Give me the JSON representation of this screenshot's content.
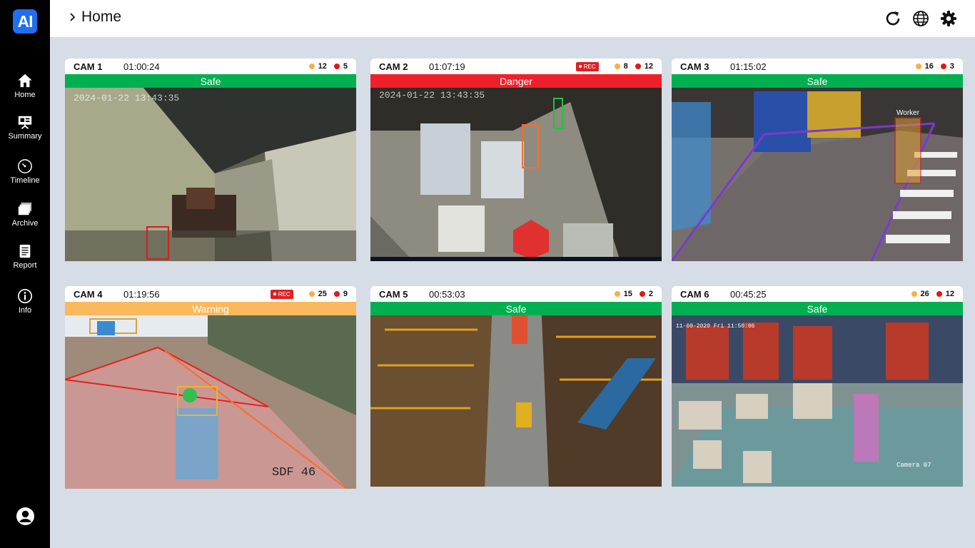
{
  "app": {
    "logo": "AI",
    "breadcrumb": "Home"
  },
  "sidebar": {
    "items": [
      {
        "label": "Home",
        "icon": "home-icon"
      },
      {
        "label": "Summary",
        "icon": "presentation-icon"
      },
      {
        "label": "Timeline",
        "icon": "clock-icon"
      },
      {
        "label": "Archive",
        "icon": "folders-icon"
      },
      {
        "label": "Report",
        "icon": "document-icon"
      },
      {
        "label": "Info",
        "icon": "info-icon"
      }
    ]
  },
  "topbar": {
    "icons": [
      "refresh-icon",
      "globe-icon",
      "settings-icon"
    ]
  },
  "status_colors": {
    "safe": "#00b050",
    "danger": "#f0202a",
    "warning": "#f9b95c",
    "count_a": "#f7b049",
    "count_b": "#e01818",
    "rec": "#e02020"
  },
  "cameras": [
    {
      "name": "CAM 1",
      "time": "01:00:24",
      "status": "Safe",
      "count_a": "12",
      "count_b": "5",
      "overlay_text": "2024-01-22 13:43:35"
    },
    {
      "name": "CAM 2",
      "time": "01:07:19",
      "status": "Danger",
      "rec": "REC",
      "count_a": "8",
      "count_b": "12",
      "overlay_text": "2024-01-22 13:43:35"
    },
    {
      "name": "CAM 3",
      "time": "01:15:02",
      "status": "Safe",
      "count_a": "16",
      "count_b": "3",
      "overlay_text": "Worker"
    },
    {
      "name": "CAM 4",
      "time": "01:19:56",
      "status": "Warning",
      "rec": "REC",
      "count_a": "25",
      "count_b": "9",
      "overlay_text": "SDF 46"
    },
    {
      "name": "CAM 5",
      "time": "00:53:03",
      "status": "Safe",
      "count_a": "15",
      "count_b": "2"
    },
    {
      "name": "CAM 6",
      "time": "00:45:25",
      "status": "Safe",
      "count_a": "26",
      "count_b": "12",
      "overlay_text": "Camera 07"
    }
  ]
}
